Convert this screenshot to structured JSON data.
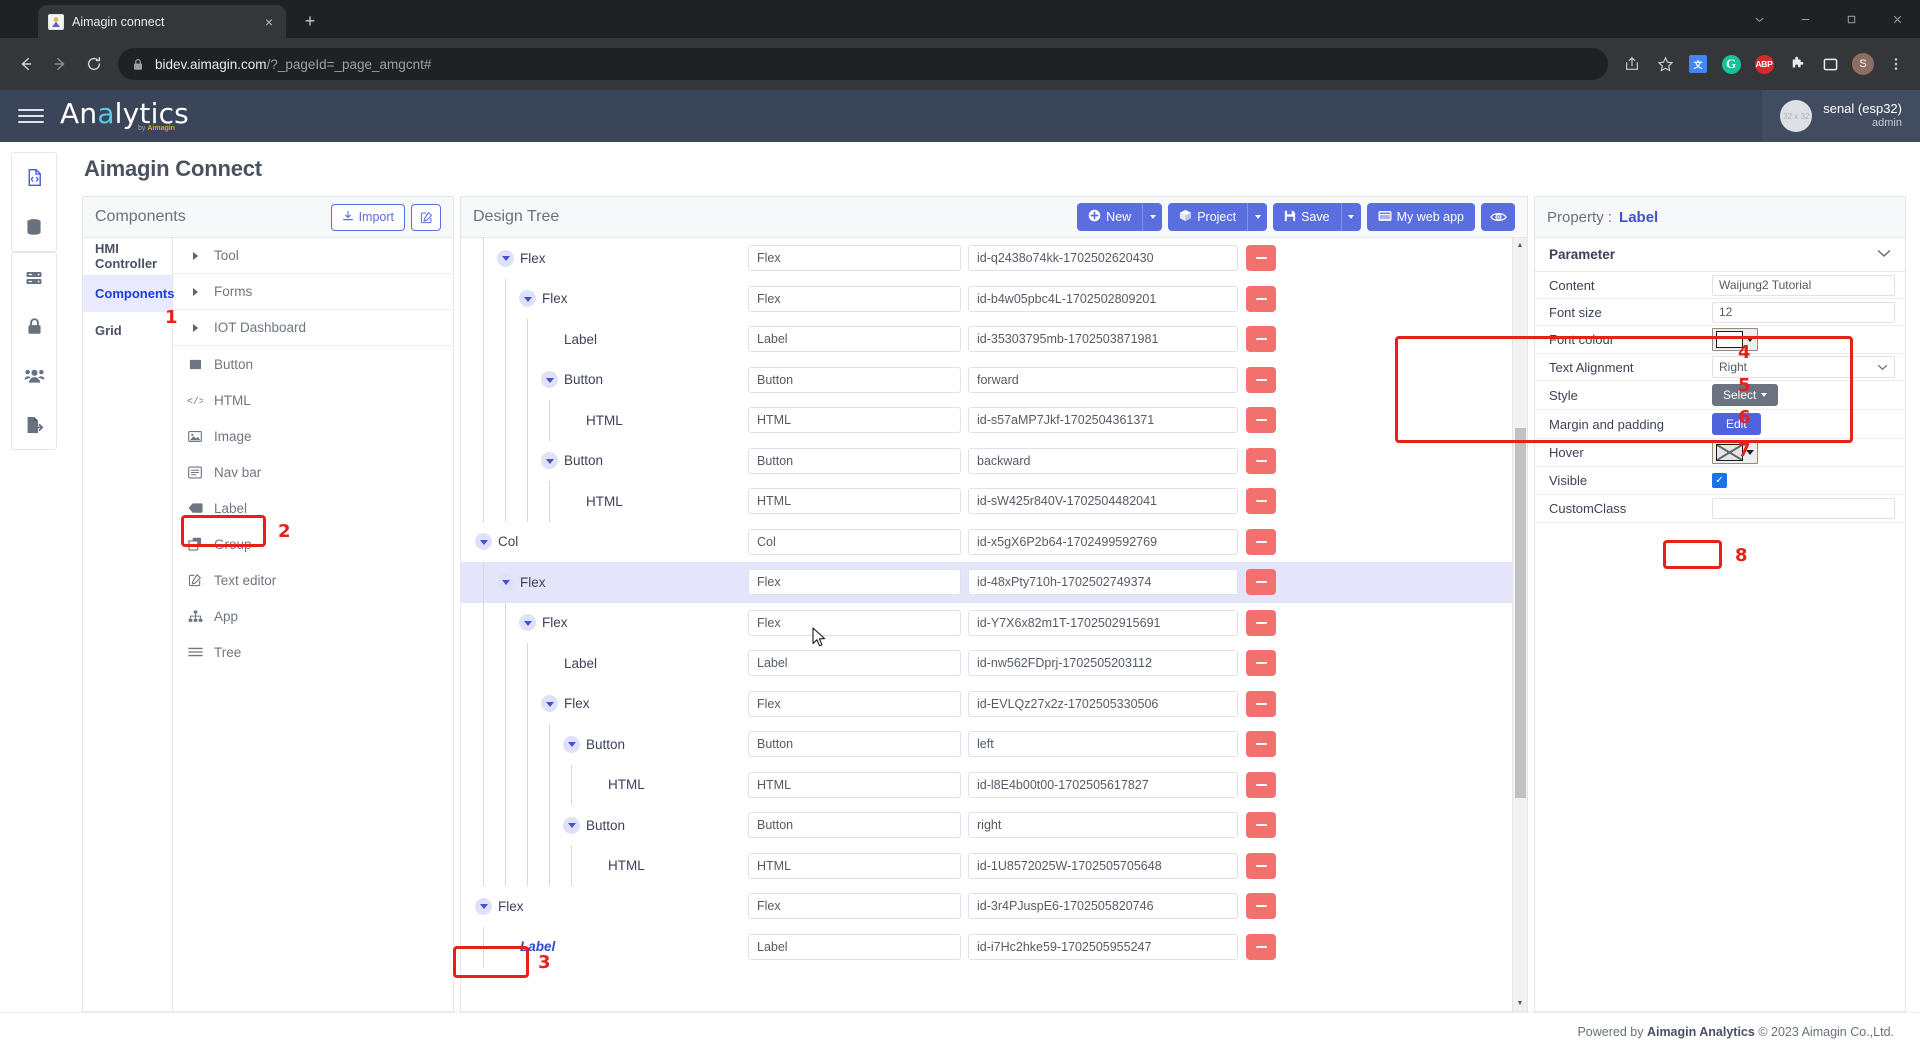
{
  "browser": {
    "tab": {
      "title": "Aimagin connect",
      "close_label": "×",
      "favicon_name": "aimagin-favicon"
    },
    "new_tab_label": "+",
    "window_controls": [
      "chevron-down",
      "minimize",
      "maximize",
      "close"
    ],
    "url_host": "bidev.aimagin.com",
    "url_path": "/?_pageId=_page_amgcnt#",
    "toolbar_icons": [
      "share-icon",
      "bookmark-star-icon",
      "google-translate-icon",
      "grammarly-icon",
      "adblock-plus-icon",
      "extensions-puzzle-icon",
      "sidepanel-icon",
      "profile-avatar-icon",
      "chrome-menu-icon"
    ],
    "extension_abp": "ABP",
    "extension_grammarly": "G",
    "extension_translate": "文",
    "profile_initial": "S"
  },
  "app": {
    "brand": {
      "main_a": "An",
      "main_hl": "a",
      "main_b": "lytics",
      "sub_by": "by ",
      "sub_name": "Aimagin"
    },
    "user": {
      "name": "senal (esp32)",
      "role": "admin",
      "avatar_text": "32 x 32"
    },
    "page_title": "Aimagin Connect",
    "rail_items": [
      {
        "name": "file-code-icon",
        "active": true
      },
      {
        "name": "database-icon",
        "active": false
      },
      {
        "name": "server-icon",
        "active": false
      },
      {
        "name": "lock-icon",
        "active": false
      },
      {
        "name": "users-icon",
        "active": false
      },
      {
        "name": "file-export-icon",
        "active": false
      }
    ],
    "footer": {
      "prefix": "Powered by ",
      "brand": "Aimagin Analytics",
      "suffix": " © 2023 Aimagin Co.,Ltd."
    }
  },
  "components_panel": {
    "title": "Components",
    "import_label": "Import",
    "edit_icon": "edit-square-icon",
    "categories": [
      {
        "label": "HMI Controller",
        "selected": false
      },
      {
        "label": "Components",
        "selected": true
      },
      {
        "label": "Grid",
        "selected": false
      }
    ],
    "groups": [
      {
        "label": "Tool"
      },
      {
        "label": "Forms"
      },
      {
        "label": "IOT Dashboard"
      }
    ],
    "items": [
      {
        "label": "Button",
        "icon": "square-filled-icon"
      },
      {
        "label": "HTML",
        "icon": "code-brackets-icon"
      },
      {
        "label": "Image",
        "icon": "image-icon"
      },
      {
        "label": "Nav bar",
        "icon": "nav-bar-icon"
      },
      {
        "label": "Label",
        "icon": "label-tag-icon",
        "highlighted": true
      },
      {
        "label": "Group",
        "icon": "group-copy-icon"
      },
      {
        "label": "Text editor",
        "icon": "pencil-square-icon"
      },
      {
        "label": "App",
        "icon": "sitemap-icon"
      },
      {
        "label": "Tree",
        "icon": "tree-lines-icon"
      }
    ]
  },
  "design_tree": {
    "title": "Design Tree",
    "buttons": {
      "new": "New",
      "project": "Project",
      "save": "Save",
      "my_web_app": "My web app",
      "preview_icon": "eye-icon"
    },
    "rows": [
      {
        "name": "Flex",
        "depth": 1,
        "caret": true,
        "type": "Flex",
        "id": "id-q2438o74kk-1702502620430",
        "selected": false
      },
      {
        "name": "Flex",
        "depth": 2,
        "caret": true,
        "type": "Flex",
        "id": "id-b4w05pbc4L-1702502809201",
        "selected": false
      },
      {
        "name": "Label",
        "depth": 3,
        "caret": false,
        "type": "Label",
        "id": "id-35303795mb-1702503871981",
        "selected": false
      },
      {
        "name": "Button",
        "depth": 3,
        "caret": true,
        "type": "Button",
        "id": "forward",
        "selected": false
      },
      {
        "name": "HTML",
        "depth": 4,
        "caret": false,
        "type": "HTML",
        "id": "id-s57aMP7Jkf-1702504361371",
        "selected": false
      },
      {
        "name": "Button",
        "depth": 3,
        "caret": true,
        "type": "Button",
        "id": "backward",
        "selected": false
      },
      {
        "name": "HTML",
        "depth": 4,
        "caret": false,
        "type": "HTML",
        "id": "id-sW425r840V-1702504482041",
        "selected": false
      },
      {
        "name": "Col",
        "depth": 0,
        "caret": true,
        "type": "Col",
        "id": "id-x5gX6P2b64-1702499592769",
        "selected": false
      },
      {
        "name": "Flex",
        "depth": 1,
        "caret": true,
        "type": "Flex",
        "id": "id-48xPty710h-1702502749374",
        "selected": true
      },
      {
        "name": "Flex",
        "depth": 2,
        "caret": true,
        "type": "Flex",
        "id": "id-Y7X6x82m1T-1702502915691",
        "selected": false
      },
      {
        "name": "Label",
        "depth": 3,
        "caret": false,
        "type": "Label",
        "id": "id-nw562FDprj-1702505203112",
        "selected": false
      },
      {
        "name": "Flex",
        "depth": 3,
        "caret": true,
        "type": "Flex",
        "id": "id-EVLQz27x2z-1702505330506",
        "selected": false
      },
      {
        "name": "Button",
        "depth": 4,
        "caret": true,
        "type": "Button",
        "id": "left",
        "selected": false
      },
      {
        "name": "HTML",
        "depth": 5,
        "caret": false,
        "type": "HTML",
        "id": "id-l8E4b00t00-1702505617827",
        "selected": false
      },
      {
        "name": "Button",
        "depth": 4,
        "caret": true,
        "type": "Button",
        "id": "right",
        "selected": false
      },
      {
        "name": "HTML",
        "depth": 5,
        "caret": false,
        "type": "HTML",
        "id": "id-1U8572025W-1702505705648",
        "selected": false
      },
      {
        "name": "Flex",
        "depth": 0,
        "caret": true,
        "type": "Flex",
        "id": "id-3r4PJuspE6-1702505820746",
        "selected": false
      },
      {
        "name": "Label",
        "depth": 1,
        "caret": false,
        "type": "Label",
        "id": "id-i7Hc2hke59-1702505955247",
        "selected": false,
        "active": true
      }
    ],
    "scroll_up": "▲",
    "scroll_down": "▼"
  },
  "property_panel": {
    "title": "Property :",
    "target": "Label",
    "section": "Parameter",
    "rows": [
      {
        "label": "Content",
        "kind": "text",
        "value": "Waijung2 Tutorial"
      },
      {
        "label": "Font size",
        "kind": "text",
        "value": "12"
      },
      {
        "label": "Font colour",
        "kind": "color",
        "value": "#ffffff"
      },
      {
        "label": "Text Alignment",
        "kind": "select",
        "value": "Right"
      },
      {
        "label": "Style",
        "kind": "btn-grey",
        "value": "Select"
      },
      {
        "label": "Margin and padding",
        "kind": "btn-blue",
        "value": "Edit"
      },
      {
        "label": "Hover",
        "kind": "color-x",
        "value": "none"
      },
      {
        "label": "Visible",
        "kind": "checkbox",
        "value": "✓"
      },
      {
        "label": "CustomClass",
        "kind": "empty",
        "value": ""
      }
    ]
  },
  "annotations": [
    {
      "n": "1",
      "target": "components-category-selected"
    },
    {
      "n": "2",
      "target": "component-item-label"
    },
    {
      "n": "3",
      "target": "tree-node-label-selected"
    },
    {
      "n": "4",
      "target": "property-content"
    },
    {
      "n": "5",
      "target": "property-font-size"
    },
    {
      "n": "6",
      "target": "property-font-colour"
    },
    {
      "n": "7",
      "target": "property-text-alignment"
    },
    {
      "n": "8",
      "target": "property-margin-padding-edit"
    }
  ],
  "colors": {
    "accent": "#5a6ee0",
    "header_bg": "#3b4559",
    "annotation_red": "#e8201a",
    "delete_red": "#f2706e",
    "selected_row": "#e4e5fb"
  }
}
